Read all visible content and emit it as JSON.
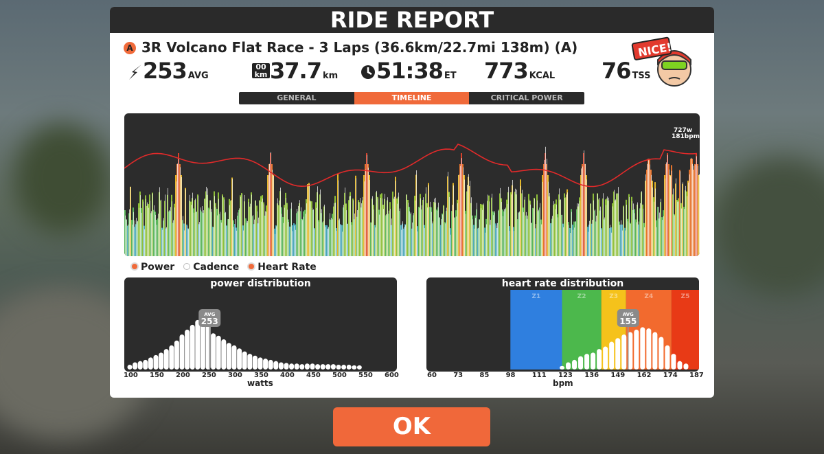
{
  "panel": {
    "title": "RIDE REPORT"
  },
  "ride": {
    "category": "A",
    "title": "3R Volcano Flat Race - 3 Laps (36.6km/22.7mi 138m) (A)"
  },
  "stats": [
    {
      "icon": "power-bolt-icon",
      "value": "253",
      "unit": "AVG"
    },
    {
      "icon": "odometer-icon",
      "value": "37.7",
      "unit": "km"
    },
    {
      "icon": "clock-icon",
      "value": "51:38",
      "unit": "ET"
    },
    {
      "icon": "",
      "value": "773",
      "unit": "KCAL"
    },
    {
      "icon": "",
      "value": "76",
      "unit": "TSS"
    }
  ],
  "badge": {
    "text": "NICE!"
  },
  "tabs": [
    {
      "label": "GENERAL",
      "active": false
    },
    {
      "label": "TIMELINE",
      "active": true
    },
    {
      "label": "CRITICAL POWER",
      "active": false
    }
  ],
  "timeline": {
    "peak_power": "727w",
    "peak_hr": "181bpm"
  },
  "legend": [
    {
      "label": "Power",
      "color": "#f06a3a"
    },
    {
      "label": "Cadence",
      "color": "#ffffff"
    },
    {
      "label": "Heart Rate",
      "color": "#f06a3a"
    }
  ],
  "power_dist": {
    "title": "power distribution",
    "xlabel": "watts",
    "avg_label": "AVG",
    "avg_value": "253",
    "avg": 253,
    "ticks": [
      "100",
      "150",
      "200",
      "250",
      "300",
      "350",
      "400",
      "450",
      "500",
      "550",
      "600"
    ],
    "bins": [
      {
        "w": 100,
        "v": 0.08
      },
      {
        "w": 110,
        "v": 0.12
      },
      {
        "w": 120,
        "v": 0.14
      },
      {
        "w": 130,
        "v": 0.16
      },
      {
        "w": 140,
        "v": 0.2
      },
      {
        "w": 150,
        "v": 0.24
      },
      {
        "w": 160,
        "v": 0.28
      },
      {
        "w": 170,
        "v": 0.34
      },
      {
        "w": 180,
        "v": 0.4
      },
      {
        "w": 190,
        "v": 0.48
      },
      {
        "w": 200,
        "v": 0.58
      },
      {
        "w": 210,
        "v": 0.66
      },
      {
        "w": 220,
        "v": 0.74
      },
      {
        "w": 230,
        "v": 0.82
      },
      {
        "w": 240,
        "v": 0.88
      },
      {
        "w": 250,
        "v": 0.76
      },
      {
        "w": 260,
        "v": 0.6
      },
      {
        "w": 270,
        "v": 0.56
      },
      {
        "w": 280,
        "v": 0.5
      },
      {
        "w": 290,
        "v": 0.44
      },
      {
        "w": 300,
        "v": 0.4
      },
      {
        "w": 310,
        "v": 0.35
      },
      {
        "w": 320,
        "v": 0.3
      },
      {
        "w": 330,
        "v": 0.26
      },
      {
        "w": 340,
        "v": 0.23
      },
      {
        "w": 350,
        "v": 0.2
      },
      {
        "w": 360,
        "v": 0.18
      },
      {
        "w": 370,
        "v": 0.16
      },
      {
        "w": 380,
        "v": 0.14
      },
      {
        "w": 390,
        "v": 0.12
      },
      {
        "w": 400,
        "v": 0.11
      },
      {
        "w": 410,
        "v": 0.1
      },
      {
        "w": 420,
        "v": 0.1
      },
      {
        "w": 430,
        "v": 0.09
      },
      {
        "w": 440,
        "v": 0.1
      },
      {
        "w": 450,
        "v": 0.1
      },
      {
        "w": 460,
        "v": 0.09
      },
      {
        "w": 470,
        "v": 0.09
      },
      {
        "w": 480,
        "v": 0.09
      },
      {
        "w": 490,
        "v": 0.09
      },
      {
        "w": 500,
        "v": 0.08
      },
      {
        "w": 510,
        "v": 0.08
      },
      {
        "w": 520,
        "v": 0.08
      },
      {
        "w": 530,
        "v": 0.07
      },
      {
        "w": 540,
        "v": 0.07
      }
    ]
  },
  "hr_dist": {
    "title": "heart rate distribution",
    "xlabel": "bpm",
    "avg_label": "AVG",
    "avg_value": "155",
    "avg": 155,
    "ticks": [
      "60",
      "73",
      "85",
      "98",
      "111",
      "123",
      "136",
      "149",
      "162",
      "174",
      "187"
    ],
    "zones": [
      {
        "label": "Z1",
        "from": 98,
        "to": 123,
        "color": "#2f7fdf"
      },
      {
        "label": "Z2",
        "from": 123,
        "to": 142,
        "color": "#4cb84c"
      },
      {
        "label": "Z3",
        "from": 142,
        "to": 154,
        "color": "#f5c21b"
      },
      {
        "label": "Z4",
        "from": 154,
        "to": 176,
        "color": "#f26a2e"
      },
      {
        "label": "Z5",
        "from": 176,
        "to": 190,
        "color": "#e83a16"
      }
    ],
    "bins": [
      {
        "b": 123,
        "v": 0.06
      },
      {
        "b": 126,
        "v": 0.12
      },
      {
        "b": 129,
        "v": 0.16
      },
      {
        "b": 132,
        "v": 0.22
      },
      {
        "b": 135,
        "v": 0.26
      },
      {
        "b": 138,
        "v": 0.28
      },
      {
        "b": 141,
        "v": 0.34
      },
      {
        "b": 144,
        "v": 0.38
      },
      {
        "b": 147,
        "v": 0.46
      },
      {
        "b": 150,
        "v": 0.52
      },
      {
        "b": 153,
        "v": 0.58
      },
      {
        "b": 156,
        "v": 0.62
      },
      {
        "b": 159,
        "v": 0.66
      },
      {
        "b": 162,
        "v": 0.7
      },
      {
        "b": 165,
        "v": 0.68
      },
      {
        "b": 168,
        "v": 0.62
      },
      {
        "b": 171,
        "v": 0.54
      },
      {
        "b": 174,
        "v": 0.4
      },
      {
        "b": 177,
        "v": 0.26
      },
      {
        "b": 180,
        "v": 0.14
      },
      {
        "b": 183,
        "v": 0.1
      }
    ]
  },
  "ok": {
    "label": "OK"
  },
  "colors": {
    "accent": "#f06a3a",
    "panel_dark": "#2a2a2a"
  }
}
